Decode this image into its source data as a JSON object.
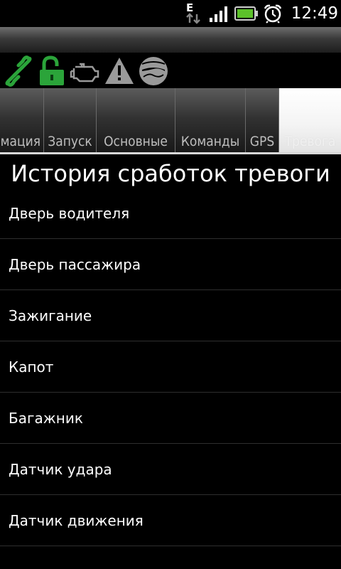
{
  "status_bar": {
    "network_type": "E",
    "time": "12:49",
    "icons": [
      "network-data-icon",
      "signal-icon",
      "battery-icon",
      "alarm-clock-icon"
    ]
  },
  "indicators": {
    "icons": [
      "link-icon",
      "unlocked-padlock-icon",
      "engine-icon",
      "warning-icon",
      "car-status-icon"
    ],
    "colors": {
      "link": "#2ba43a",
      "padlock": "#2ba43a",
      "inactive": "#9a9a9a"
    }
  },
  "tabs": [
    {
      "label": "мация",
      "active": false
    },
    {
      "label": "Запуск",
      "active": false
    },
    {
      "label": "Основные",
      "active": false
    },
    {
      "label": "Команды",
      "active": false
    },
    {
      "label": "GPS",
      "active": false
    },
    {
      "label": "Тревога",
      "active": true
    }
  ],
  "page": {
    "title": "История сработок тревоги"
  },
  "alarm_list": [
    {
      "label": "Дверь водителя"
    },
    {
      "label": "Дверь пассажира"
    },
    {
      "label": "Зажигание"
    },
    {
      "label": "Капот"
    },
    {
      "label": "Багажник"
    },
    {
      "label": "Датчик удара"
    },
    {
      "label": "Датчик движения"
    }
  ]
}
